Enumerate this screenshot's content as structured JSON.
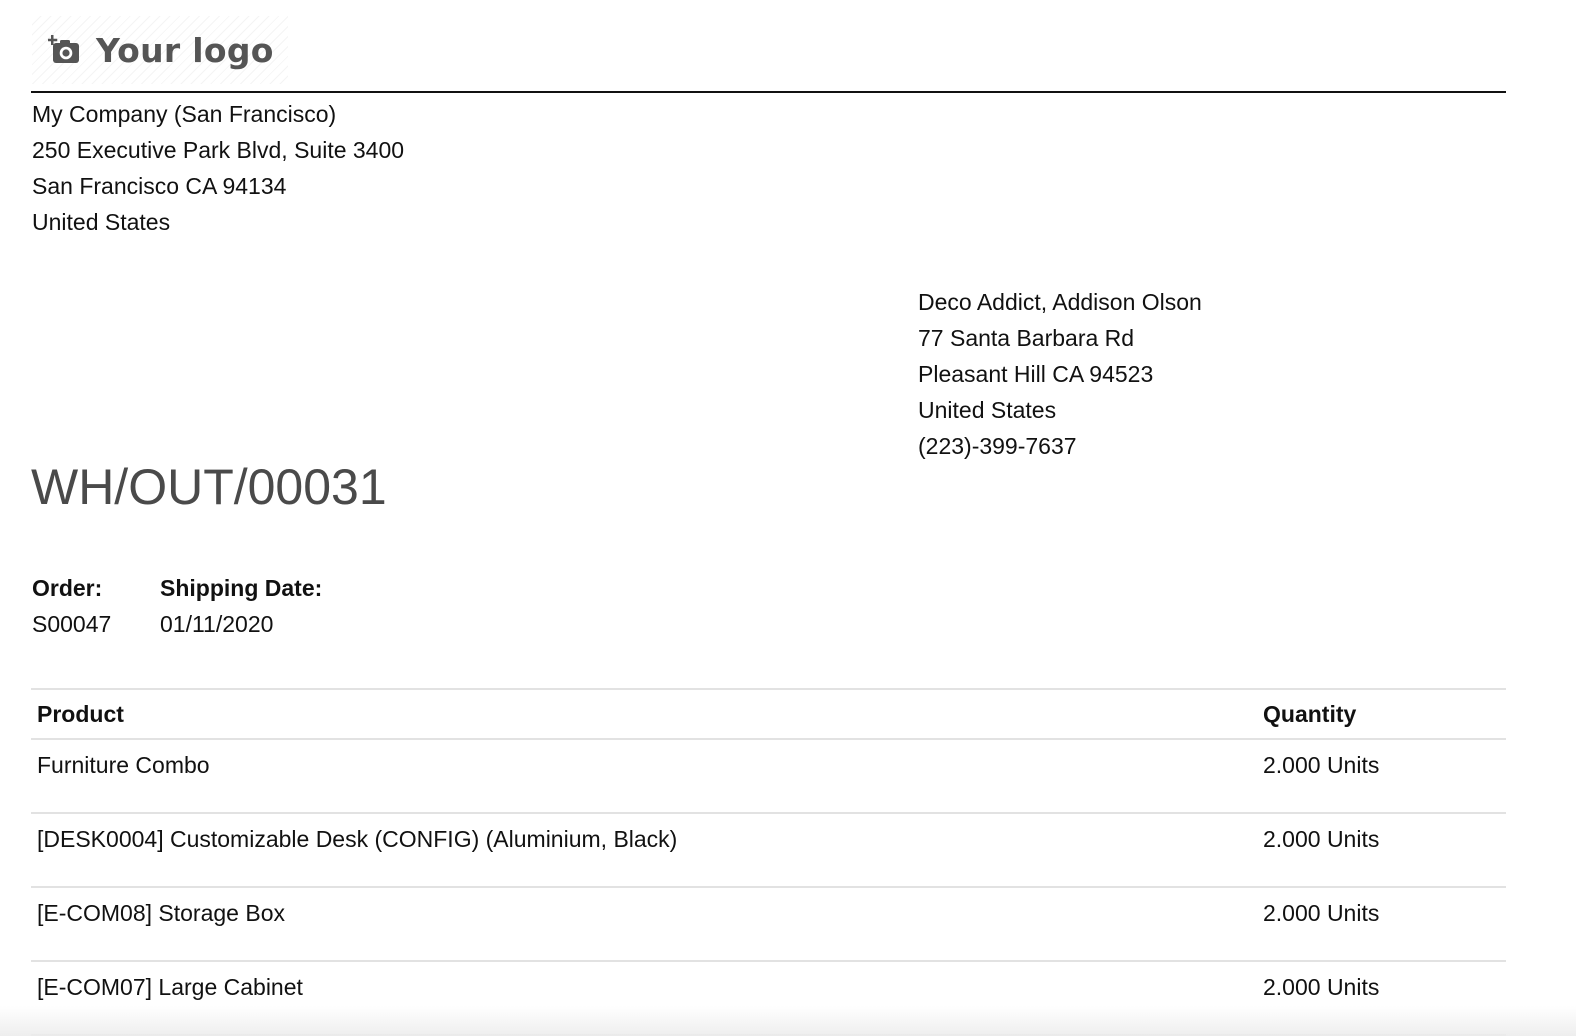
{
  "logo": {
    "text": "Your logo",
    "icon": "camera-plus-icon"
  },
  "company": {
    "lines": [
      "My Company (San Francisco)",
      "250 Executive Park Blvd, Suite 3400",
      "San Francisco CA 94134",
      "United States"
    ]
  },
  "customer": {
    "lines": [
      "Deco Addict, Addison Olson",
      "77 Santa Barbara Rd",
      "Pleasant Hill CA 94523",
      "United States",
      "(223)-399-7637"
    ]
  },
  "document": {
    "title": "WH/OUT/00031"
  },
  "info": {
    "order_label": "Order:",
    "order_value": "S00047",
    "date_label": "Shipping Date:",
    "date_value": "01/11/2020"
  },
  "table": {
    "headers": {
      "product": "Product",
      "quantity": "Quantity"
    },
    "rows": [
      {
        "product": "Furniture Combo",
        "quantity": "2.000 Units"
      },
      {
        "product": "[DESK0004] Customizable Desk (CONFIG) (Aluminium, Black)",
        "quantity": "2.000 Units"
      },
      {
        "product": "[E-COM08] Storage Box",
        "quantity": "2.000 Units"
      },
      {
        "product": "[E-COM07] Large Cabinet",
        "quantity": "2.000 Units"
      }
    ]
  },
  "colors": {
    "title": "#4a4a4a",
    "rule": "#111111",
    "row_border": "#e2e2e2",
    "logo_text": "#555555"
  }
}
